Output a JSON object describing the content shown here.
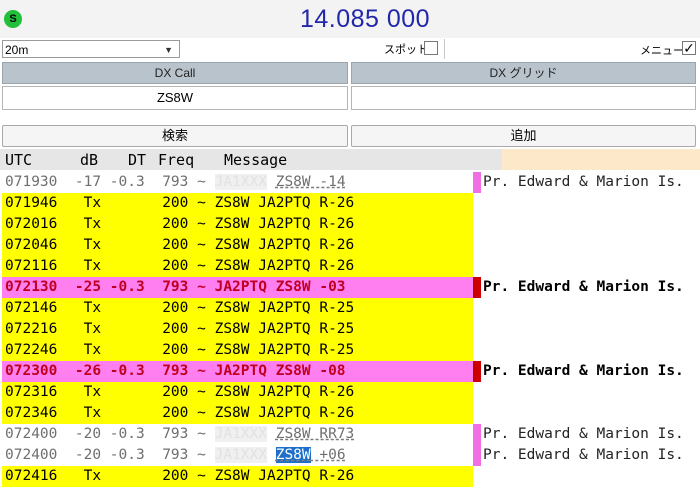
{
  "header": {
    "status_badge": "S",
    "frequency": "14.085 000"
  },
  "controls": {
    "band": "20m",
    "spot_label": "スポット",
    "spot_checked": false,
    "menu_label": "メニュー",
    "menu_checked": true
  },
  "dx": {
    "call_header": "DX Call",
    "grid_header": "DX グリッド",
    "call_value": "ZS8W",
    "grid_value": ""
  },
  "buttons": {
    "search": "検索",
    "add": "追加"
  },
  "table": {
    "columns": [
      "UTC",
      "dB",
      "DT",
      "Freq",
      "Message"
    ],
    "rows": [
      {
        "type": "decode",
        "utc": "071930",
        "db": "-17",
        "dt": "-0.3",
        "freq": "793",
        "sep": "~",
        "hidden": "JA1XXX",
        "msg": "ZS8W -14",
        "place": "Pr. Edward & Marion Is."
      },
      {
        "type": "tx",
        "utc": "071946",
        "db": "Tx",
        "dt": "",
        "freq": "200",
        "sep": "~",
        "msg": "ZS8W JA2PTQ R-26",
        "place": ""
      },
      {
        "type": "tx",
        "utc": "072016",
        "db": "Tx",
        "dt": "",
        "freq": "200",
        "sep": "~",
        "msg": "ZS8W JA2PTQ R-26",
        "place": ""
      },
      {
        "type": "tx",
        "utc": "072046",
        "db": "Tx",
        "dt": "",
        "freq": "200",
        "sep": "~",
        "msg": "ZS8W JA2PTQ R-26",
        "place": ""
      },
      {
        "type": "tx",
        "utc": "072116",
        "db": "Tx",
        "dt": "",
        "freq": "200",
        "sep": "~",
        "msg": "ZS8W JA2PTQ R-26",
        "place": ""
      },
      {
        "type": "hl",
        "utc": "072130",
        "db": "-25",
        "dt": "-0.3",
        "freq": "793",
        "sep": "~",
        "msg": "JA2PTQ ZS8W -03",
        "place": "Pr. Edward & Marion Is."
      },
      {
        "type": "tx",
        "utc": "072146",
        "db": "Tx",
        "dt": "",
        "freq": "200",
        "sep": "~",
        "msg": "ZS8W JA2PTQ R-25",
        "place": ""
      },
      {
        "type": "tx",
        "utc": "072216",
        "db": "Tx",
        "dt": "",
        "freq": "200",
        "sep": "~",
        "msg": "ZS8W JA2PTQ R-25",
        "place": ""
      },
      {
        "type": "tx",
        "utc": "072246",
        "db": "Tx",
        "dt": "",
        "freq": "200",
        "sep": "~",
        "msg": "ZS8W JA2PTQ R-25",
        "place": ""
      },
      {
        "type": "hl",
        "utc": "072300",
        "db": "-26",
        "dt": "-0.3",
        "freq": "793",
        "sep": "~",
        "msg": "JA2PTQ ZS8W -08",
        "place": "Pr. Edward & Marion Is."
      },
      {
        "type": "tx",
        "utc": "072316",
        "db": "Tx",
        "dt": "",
        "freq": "200",
        "sep": "~",
        "msg": "ZS8W JA2PTQ R-26",
        "place": ""
      },
      {
        "type": "tx",
        "utc": "072346",
        "db": "Tx",
        "dt": "",
        "freq": "200",
        "sep": "~",
        "msg": "ZS8W JA2PTQ R-26",
        "place": ""
      },
      {
        "type": "decode",
        "utc": "072400",
        "db": "-20",
        "dt": "-0.3",
        "freq": "793",
        "sep": "~",
        "hidden": "JA1XXX",
        "msg": "ZS8W RR73",
        "place": "Pr. Edward & Marion Is."
      },
      {
        "type": "decode",
        "utc": "072400",
        "db": "-20",
        "dt": "-0.3",
        "freq": "793",
        "sep": "~",
        "hidden": "JA1XXX",
        "msg": "ZS8W +06",
        "sel": "ZS8W",
        "rest": " +06",
        "place": "Pr. Edward & Marion Is."
      },
      {
        "type": "tx",
        "utc": "072416",
        "db": "Tx",
        "dt": "",
        "freq": "200",
        "sep": "~",
        "msg": "ZS8W JA2PTQ R-26",
        "place": ""
      }
    ]
  },
  "colors": {
    "tx_row": "#ffff00",
    "highlight_row": "#ff7ff0",
    "highlight_text": "#c00020",
    "frequency_text": "#2226a8"
  }
}
